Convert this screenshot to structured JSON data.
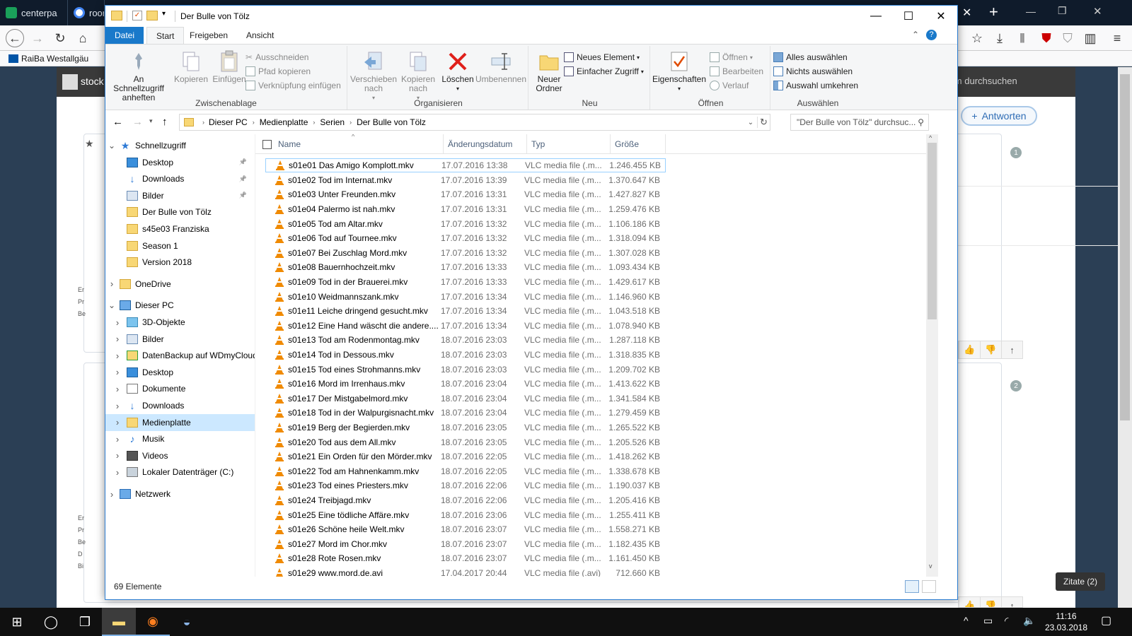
{
  "browser": {
    "tabs": [
      {
        "label": "centerpa",
        "fav": "#1aa05a"
      },
      {
        "label": "roor",
        "fav": "#4285f4"
      }
    ],
    "bookmark": "RaiBa Westallgäu",
    "site_header_left": "stock",
    "site_search": "orum durchsuchen",
    "reply_button": "Antworten",
    "badge1": "1",
    "badge2": "2",
    "zitate": "Zitate (2)",
    "side_letters": [
      "Er",
      "Pr",
      "Be",
      "Er",
      "Pr",
      "Be",
      "D",
      "Bi"
    ]
  },
  "window": {
    "title": "Der Bulle von Tölz",
    "ribbon_tabs": [
      "Datei",
      "Start",
      "Freigeben",
      "Ansicht"
    ],
    "groups": {
      "clipboard": {
        "label": "Zwischenablage",
        "pin": "An Schnellzugriff anheften",
        "copy": "Kopieren",
        "paste": "Einfügen",
        "cut": "Ausschneiden",
        "copy_path": "Pfad kopieren",
        "paste_link": "Verknüpfung einfügen"
      },
      "organize": {
        "label": "Organisieren",
        "move": "Verschieben nach",
        "copyto": "Kopieren nach",
        "delete": "Löschen",
        "rename": "Umbenennen"
      },
      "new": {
        "label": "Neu",
        "folder": "Neuer Ordner",
        "item": "Neues Element",
        "easy": "Einfacher Zugriff"
      },
      "open": {
        "label": "Öffnen",
        "props": "Eigenschaften",
        "open": "Öffnen",
        "edit": "Bearbeiten",
        "history": "Verlauf"
      },
      "select": {
        "label": "Auswählen",
        "all": "Alles auswählen",
        "none": "Nichts auswählen",
        "invert": "Auswahl umkehren"
      }
    },
    "breadcrumb": [
      "Dieser PC",
      "Medienplatte",
      "Serien",
      "Der Bulle von Tölz"
    ],
    "search_placeholder": "\"Der Bulle von Tölz\" durchsuc...",
    "columns": [
      "Name",
      "Änderungsdatum",
      "Typ",
      "Größe"
    ],
    "nav": [
      {
        "label": "Schnellzugriff",
        "level": 0,
        "chev": "v",
        "icon": "star",
        "pin": false
      },
      {
        "label": "Desktop",
        "level": 1,
        "chev": "",
        "icon": "desktop",
        "pin": true
      },
      {
        "label": "Downloads",
        "level": 1,
        "chev": "",
        "icon": "download",
        "pin": true
      },
      {
        "label": "Bilder",
        "level": 1,
        "chev": "",
        "icon": "pictures",
        "pin": true
      },
      {
        "label": "Der Bulle von Tölz",
        "level": 1,
        "chev": "",
        "icon": "folder",
        "pin": false
      },
      {
        "label": "s45e03 Franziska",
        "level": 1,
        "chev": "",
        "icon": "folder",
        "pin": false
      },
      {
        "label": "Season 1",
        "level": 1,
        "chev": "",
        "icon": "folder",
        "pin": false
      },
      {
        "label": "Version 2018",
        "level": 1,
        "chev": "",
        "icon": "folder",
        "pin": false
      },
      {
        "label": "OneDrive",
        "level": 0,
        "chev": ">",
        "icon": "folder",
        "pin": false,
        "gap": true
      },
      {
        "label": "Dieser PC",
        "level": 0,
        "chev": "v",
        "icon": "pc",
        "pin": false,
        "gap": true
      },
      {
        "label": "3D-Objekte",
        "level": 1,
        "chev": ">",
        "icon": "cube",
        "pin": false
      },
      {
        "label": "Bilder",
        "level": 1,
        "chev": ">",
        "icon": "pictures",
        "pin": false
      },
      {
        "label": "DatenBackup auf WDmyCloud",
        "level": 1,
        "chev": ">",
        "icon": "netfolder",
        "pin": false
      },
      {
        "label": "Desktop",
        "level": 1,
        "chev": ">",
        "icon": "desktop",
        "pin": false
      },
      {
        "label": "Dokumente",
        "level": 1,
        "chev": ">",
        "icon": "docs",
        "pin": false
      },
      {
        "label": "Downloads",
        "level": 1,
        "chev": ">",
        "icon": "download",
        "pin": false
      },
      {
        "label": "Medienplatte",
        "level": 1,
        "chev": ">",
        "icon": "folder",
        "pin": false,
        "selected": true
      },
      {
        "label": "Musik",
        "level": 1,
        "chev": ">",
        "icon": "music",
        "pin": false
      },
      {
        "label": "Videos",
        "level": 1,
        "chev": ">",
        "icon": "video",
        "pin": false
      },
      {
        "label": "Lokaler Datenträger (C:)",
        "level": 1,
        "chev": ">",
        "icon": "drive",
        "pin": false
      },
      {
        "label": "Netzwerk",
        "level": 0,
        "chev": ">",
        "icon": "network",
        "pin": false,
        "gap": true
      }
    ],
    "files": [
      {
        "name": "s01e01 Das Amigo Komplott.mkv",
        "date": "17.07.2016 13:38",
        "type": "VLC media file (.m...",
        "size": "1.246.455 KB"
      },
      {
        "name": "s01e02 Tod im Internat.mkv",
        "date": "17.07.2016 13:39",
        "type": "VLC media file (.m...",
        "size": "1.370.647 KB"
      },
      {
        "name": "s01e03 Unter Freunden.mkv",
        "date": "17.07.2016 13:31",
        "type": "VLC media file (.m...",
        "size": "1.427.827 KB"
      },
      {
        "name": "s01e04 Palermo ist nah.mkv",
        "date": "17.07.2016 13:31",
        "type": "VLC media file (.m...",
        "size": "1.259.476 KB"
      },
      {
        "name": "s01e05 Tod am Altar.mkv",
        "date": "17.07.2016 13:32",
        "type": "VLC media file (.m...",
        "size": "1.106.186 KB"
      },
      {
        "name": "s01e06 Tod auf Tournee.mkv",
        "date": "17.07.2016 13:32",
        "type": "VLC media file (.m...",
        "size": "1.318.094 KB"
      },
      {
        "name": "s01e07 Bei Zuschlag Mord.mkv",
        "date": "17.07.2016 13:32",
        "type": "VLC media file (.m...",
        "size": "1.307.028 KB"
      },
      {
        "name": "s01e08 Bauernhochzeit.mkv",
        "date": "17.07.2016 13:33",
        "type": "VLC media file (.m...",
        "size": "1.093.434 KB"
      },
      {
        "name": "s01e09 Tod in der Brauerei.mkv",
        "date": "17.07.2016 13:33",
        "type": "VLC media file (.m...",
        "size": "1.429.617 KB"
      },
      {
        "name": "s01e10 Weidmannszank.mkv",
        "date": "17.07.2016 13:34",
        "type": "VLC media file (.m...",
        "size": "1.146.960 KB"
      },
      {
        "name": "s01e11 Leiche dringend gesucht.mkv",
        "date": "17.07.2016 13:34",
        "type": "VLC media file (.m...",
        "size": "1.043.518 KB"
      },
      {
        "name": "s01e12 Eine Hand wäscht die andere....",
        "date": "17.07.2016 13:34",
        "type": "VLC media file (.m...",
        "size": "1.078.940 KB"
      },
      {
        "name": "s01e13 Tod am Rodenmontag.mkv",
        "date": "18.07.2016 23:03",
        "type": "VLC media file (.m...",
        "size": "1.287.118 KB"
      },
      {
        "name": "s01e14 Tod in Dessous.mkv",
        "date": "18.07.2016 23:03",
        "type": "VLC media file (.m...",
        "size": "1.318.835 KB"
      },
      {
        "name": "s01e15 Tod eines Strohmanns.mkv",
        "date": "18.07.2016 23:03",
        "type": "VLC media file (.m...",
        "size": "1.209.702 KB"
      },
      {
        "name": "s01e16 Mord im Irrenhaus.mkv",
        "date": "18.07.2016 23:04",
        "type": "VLC media file (.m...",
        "size": "1.413.622 KB"
      },
      {
        "name": "s01e17 Der Mistgabelmord.mkv",
        "date": "18.07.2016 23:04",
        "type": "VLC media file (.m...",
        "size": "1.341.584 KB"
      },
      {
        "name": "s01e18 Tod in der Walpurgisnacht.mkv",
        "date": "18.07.2016 23:04",
        "type": "VLC media file (.m...",
        "size": "1.279.459 KB"
      },
      {
        "name": "s01e19 Berg der Begierden.mkv",
        "date": "18.07.2016 23:05",
        "type": "VLC media file (.m...",
        "size": "1.265.522 KB"
      },
      {
        "name": "s01e20 Tod aus dem All.mkv",
        "date": "18.07.2016 23:05",
        "type": "VLC media file (.m...",
        "size": "1.205.526 KB"
      },
      {
        "name": "s01e21 Ein Orden für den Mörder.mkv",
        "date": "18.07.2016 22:05",
        "type": "VLC media file (.m...",
        "size": "1.418.262 KB"
      },
      {
        "name": "s01e22 Tod am Hahnenkamm.mkv",
        "date": "18.07.2016 22:05",
        "type": "VLC media file (.m...",
        "size": "1.338.678 KB"
      },
      {
        "name": "s01e23 Tod eines Priesters.mkv",
        "date": "18.07.2016 22:06",
        "type": "VLC media file (.m...",
        "size": "1.190.037 KB"
      },
      {
        "name": "s01e24 Treibjagd.mkv",
        "date": "18.07.2016 22:06",
        "type": "VLC media file (.m...",
        "size": "1.205.416 KB"
      },
      {
        "name": "s01e25 Eine tödliche Affäre.mkv",
        "date": "18.07.2016 23:06",
        "type": "VLC media file (.m...",
        "size": "1.255.411 KB"
      },
      {
        "name": "s01e26 Schöne heile Welt.mkv",
        "date": "18.07.2016 23:07",
        "type": "VLC media file (.m...",
        "size": "1.558.271 KB"
      },
      {
        "name": "s01e27 Mord im Chor.mkv",
        "date": "18.07.2016 23:07",
        "type": "VLC media file (.m...",
        "size": "1.182.435 KB"
      },
      {
        "name": "s01e28 Rote Rosen.mkv",
        "date": "18.07.2016 23:07",
        "type": "VLC media file (.m...",
        "size": "1.161.450 KB"
      },
      {
        "name": "s01e29 www.mord.de.avi",
        "date": "17.04.2017 20:44",
        "type": "VLC media file (.avi)",
        "size": "712.660 KB"
      }
    ],
    "status": "69 Elemente"
  },
  "taskbar": {
    "time": "11:16",
    "date": "23.03.2018"
  },
  "colors": {
    "accent": "#1979ca",
    "selection": "#cce8ff",
    "folder": "#f8d775",
    "vlc": "#f08a00"
  }
}
